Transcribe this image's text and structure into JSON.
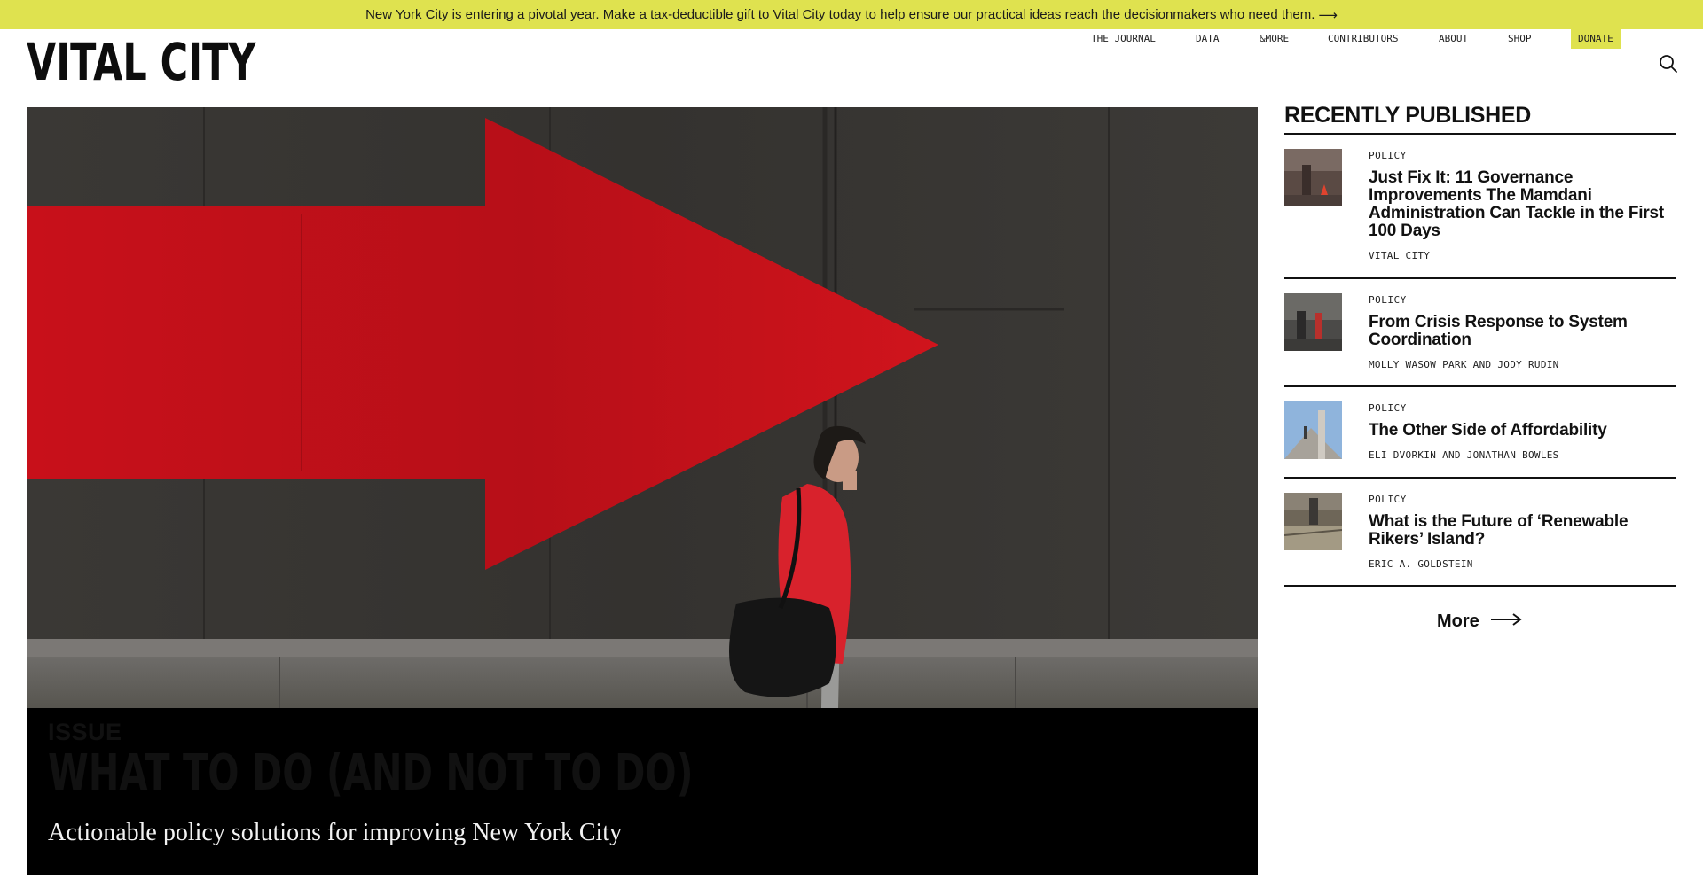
{
  "banner": {
    "text": "New York City is entering a pivotal year. Make a tax-deductible gift to Vital City today to help ensure our practical ideas reach the decisionmakers who need them.",
    "arrow": "⟶",
    "color": "#dfe24f"
  },
  "header": {
    "logo": "VITAL CITY",
    "nav": [
      {
        "label": "THE JOURNAL"
      },
      {
        "label": "DATA"
      },
      {
        "label": "&MORE"
      },
      {
        "label": "CONTRIBUTORS"
      },
      {
        "label": "ABOUT"
      },
      {
        "label": "SHOP"
      },
      {
        "label": "DONATE"
      }
    ],
    "search_icon": "search-icon"
  },
  "hero": {
    "label": "ISSUE",
    "title": "WHAT TO DO (AND NOT TO DO)",
    "subtitle": "Actionable policy solutions for improving New York City",
    "image": "red-arrow-woman-walking-photo"
  },
  "sidebar": {
    "heading": "RECENTLY PUBLISHED",
    "articles": [
      {
        "category": "POLICY",
        "title": "Just Fix It: 11 Governance Improvements The Mamdani Administration Can Tackle in the First 100 Days",
        "author": "VITAL CITY"
      },
      {
        "category": "POLICY",
        "title": "From Crisis Response to System Coordination",
        "author": "MOLLY WASOW PARK AND JODY RUDIN"
      },
      {
        "category": "POLICY",
        "title": "The Other Side of Affordability",
        "author": "ELI DVORKIN AND JONATHAN BOWLES"
      },
      {
        "category": "POLICY",
        "title": "What is the Future of ‘Renewable Rikers’ Island?",
        "author": "ERIC A. GOLDSTEIN"
      }
    ],
    "more_label": "More"
  }
}
